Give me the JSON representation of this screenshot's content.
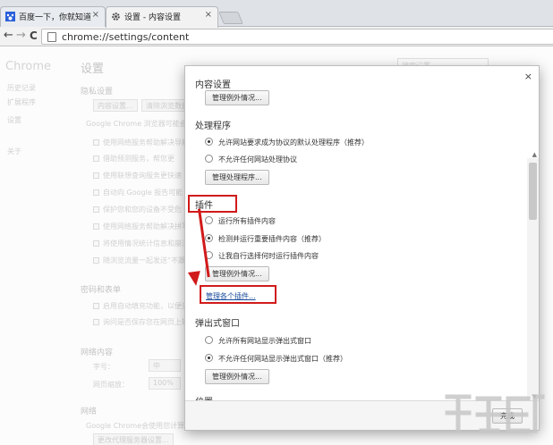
{
  "tabs": [
    {
      "title": "百度一下，你就知道",
      "close": "×"
    },
    {
      "title": "设置 - 内容设置",
      "close": "×"
    }
  ],
  "toolbar": {
    "back": "←",
    "forward": "→",
    "reload": "C",
    "url": "chrome://settings/content"
  },
  "background": {
    "sidebar_title": "Chrome",
    "sidebar_items": [
      "历史记录",
      "扩展程序",
      "设置",
      "关于"
    ],
    "page_title": "设置",
    "search_placeholder": "搜索设置",
    "privacy_heading": "隐私设置",
    "privacy_buttons": [
      "内容设置...",
      "清除浏览数据..."
    ],
    "privacy_desc": "Google Chrome 浏览器可能会使",
    "privacy_options": [
      "使用网络服务帮助解决导航",
      "借助预测服务，帮您更",
      "使用联想查询服务更快速",
      "自动向 Google 报告可能",
      "保护您和您的设备不受危",
      "使用网络服务帮助解决拼写",
      "将使用情况统计信息和崩溃",
      "随浏览流量一起发送“不跟踪"
    ],
    "password_heading": "密码和表单",
    "password_options": [
      "启用自动填充功能，以便只",
      "询问是否保存您在网页上输"
    ],
    "webcontent_heading": "网络内容",
    "font_label": "字号：",
    "font_value": "中",
    "zoom_label": "网页缩放：",
    "zoom_value": "100%",
    "network_heading": "网络",
    "network_desc": "Google Chrome会使用您计算机",
    "proxy_button": "更改代理服务器设置..."
  },
  "dialog": {
    "title": "内容设置",
    "close": "×",
    "manage_exceptions_1": "管理例外情况...",
    "handlers_heading": "处理程序",
    "handlers_options": [
      "允许网站要求成为协议的默认处理程序（推荐）",
      "不允许任何网站处理协议"
    ],
    "manage_handlers": "管理处理程序...",
    "plugins_heading": "插件",
    "plugins_options": [
      "运行所有插件内容",
      "检测并运行重要插件内容（推荐）",
      "让我自行选择何时运行插件内容"
    ],
    "manage_exceptions_2": "管理例外情况...",
    "manage_plugins_link": "管理各个插件...",
    "popups_heading": "弹出式窗口",
    "popups_options": [
      "允许所有网站显示弹出式窗口",
      "不允许任何网站显示弹出式窗口（推荐）"
    ],
    "manage_exceptions_3": "管理例外情况...",
    "location_heading": "位置",
    "done": "完成"
  },
  "colors": {
    "highlight": "#d11a1a",
    "link": "#1a4c9c"
  },
  "icons": [
    "baidu-paw-icon",
    "gear-icon",
    "page-icon",
    "back-arrow-icon",
    "forward-arrow-icon",
    "reload-icon"
  ]
}
